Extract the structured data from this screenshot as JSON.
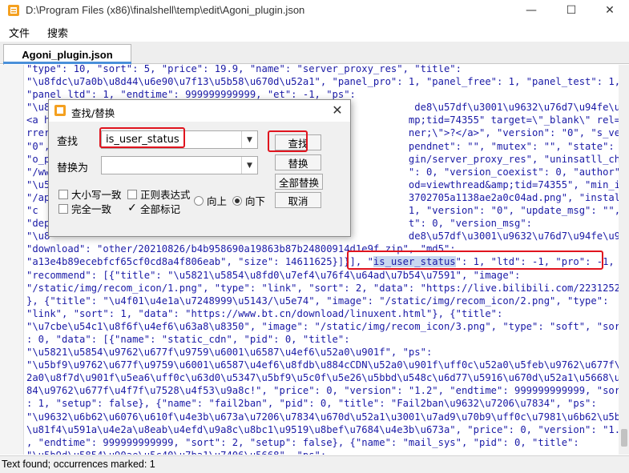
{
  "window": {
    "title": "D:\\Program Files (x86)\\finalshell\\temp\\edit\\Agoni_plugin.json",
    "minimize": "—",
    "maximize": "☐",
    "close": "✕"
  },
  "menu": {
    "file": "文件",
    "search": "搜索"
  },
  "tab": {
    "label": "Agoni_plugin.json"
  },
  "editor": {
    "lines": [
      "\"type\": 10, \"sort\": 5, \"price\": 19.9, \"name\": \"server_proxy_res\", \"title\":",
      "\"\\u8fdc\\u7a0b\\u8d44\\u6e90\\u7f13\\u5b58\\u670d\\u52a1\", \"panel_pro\": 1, \"panel_free\": 1, \"panel_test\": 1,",
      "\"panel_ltd\": 1, \"endtime\": 999999999999, \"et\": -1, \"ps\":",
      "\"\\u8                                                              de8\\u57df\\u3001\\u9632\\u76d7\\u94fe\\u9650\\u5236",
      "<a h                                                             mp;tid=74355\" target=\\\"_blank\\\" rel=\\\"norefe",
      "rrer                                                             ner;\\\">?</a>\", \"version\": \"0\", \"s_version\":",
      "\"0\",                                                             pendnet\": \"\", \"mutex\": \"\", \"state\": 0,",
      "\"o_p                                                             gin/server_proxy_res\", \"uninsatll_checks\":",
      "\"/ww                                                             \": 0, \"version_coexist\": 0, \"author\":",
      "\"\\u5                                                             od=viewthread&amp;tid=74355\", \"min_image\":",
      "\"/ap                                                             3702705a1138ae2a0c04ad.png\", \"install_opt\": 0,",
      "\"c                                                               1, \"version\": \"0\", \"update_msg\": \"\",",
      "\"dep                                                             t\": 0, \"version_msg\":",
      "\"\\u8                                                             de8\\u57df\\u3001\\u9632\\u76d7\\u94fe\\u9650\\u5236",
      "\"download\": \"other/20210826/b4b958690a19863b87b24800914d1e9f.zip\", \"md5\":",
      "\"a13e4b89ecebfcf65cf0cd8a4f806eab\", \"size\": 14611625}]}], \"",
      "\"recommend\": [{\"title\": \"\\u5821\\u5854\\u8fd0\\u7ef4\\u76f4\\u64ad\\u7b54\\u7591\", \"image\":",
      "\"/static/img/recom_icon/1.png\", \"type\": \"link\", \"sort\": 2, \"data\": \"https://live.bilibili.com/22312524\"",
      "}, {\"title\": \"\\u4f01\\u4e1a\\u7248999\\u5143/\\u5e74\", \"image\": \"/static/img/recom_icon/2.png\", \"type\":",
      "\"link\", \"sort\": 1, \"data\": \"https://www.bt.cn/download/linuxent.html\"}, {\"title\":",
      "\"\\u7cbe\\u54c1\\u8f6f\\u4ef6\\u63a8\\u8350\", \"image\": \"/static/img/recom_icon/3.png\", \"type\": \"soft\", \"sort\"",
      ": 0, \"data\": [{\"name\": \"static_cdn\", \"pid\": 0, \"title\":",
      "\"\\u5821\\u5854\\u9762\\u677f\\u9759\\u6001\\u6587\\u4ef6\\u52a0\\u901f\", \"ps\":",
      "\"\\u5bf9\\u9762\\u677f\\u9759\\u6001\\u6587\\u4ef6\\u8fdb\\u884cCDN\\u52a0\\u901f\\uff0c\\u52a0\\u5feb\\u9762\\u677f\\u5",
      "2a0\\u8f7d\\u901f\\u5ea6\\uff0c\\u63d0\\u5347\\u5bf9\\u5c0f\\u5e26\\u5bbd\\u548c\\u6d77\\u5916\\u670d\\u52a1\\u5668\\u76",
      "84\\u9762\\u677f\\u4f7f\\u7528\\u4f53\\u9a8c!\", \"price\": 0, \"version\": \"1.2\", \"endtime\": 999999999999, \"sort\"",
      ": 1, \"setup\": false}, {\"name\": \"fail2ban\", \"pid\": 0, \"title\": \"Fail2ban\\u9632\\u7206\\u7834\", \"ps\":",
      "\"\\u9632\\u6b62\\u6076\\u610f\\u4e3b\\u673a\\u7206\\u7834\\u670d\\u52a1\\u3001\\u7ad9\\u70b9\\uff0c\\u7981\\u6b62\\u5bfc",
      "\\u81f4\\u591a\\u4e2a\\u8eab\\u4efd\\u9a8c\\u8bc1\\u9519\\u8bef\\u7684\\u4e3b\\u673a\", \"price\": 0, \"version\": \"1.7\"",
      ", \"endtime\": 999999999999, \"sort\": 2, \"setup\": false}, {\"name\": \"mail_sys\", \"pid\": 0, \"title\":",
      "\"\\u5b9d\\u5854\\u90ae\\u5c40\\u7ba1\\u7406\\u5668\", \"ps\":"
    ],
    "match_line": {
      "prefix": "\"a13e4b89ecebfcf65cf0cd8a4f806eab\", \"size\": 14611625}]}], \"",
      "match": "is_user_status",
      "suffix": "\": 1, \"ltd\": -1, \"pro\": -1,"
    }
  },
  "dialog": {
    "title": "查找/替换",
    "close": "✕",
    "find_label": "查找",
    "find_value": "is_user_status",
    "replace_label": "替换为",
    "replace_value": "",
    "btn_find": "查找",
    "btn_replace": "替换",
    "btn_replace_all": "全部替换",
    "btn_cancel": "取消",
    "opt_case": "大小写一致",
    "opt_regex": "正则表达式",
    "opt_whole": "完全一致",
    "opt_mark_all": "全部标记",
    "dir_up": "向上",
    "dir_down": "向下",
    "checkmark": "✓"
  },
  "status": {
    "text": "Text found; occurrences marked: 1"
  },
  "colors": {
    "highlight": "#c8d7f0",
    "annotation_red": "#e0141e",
    "string": "#1a1aa6"
  }
}
